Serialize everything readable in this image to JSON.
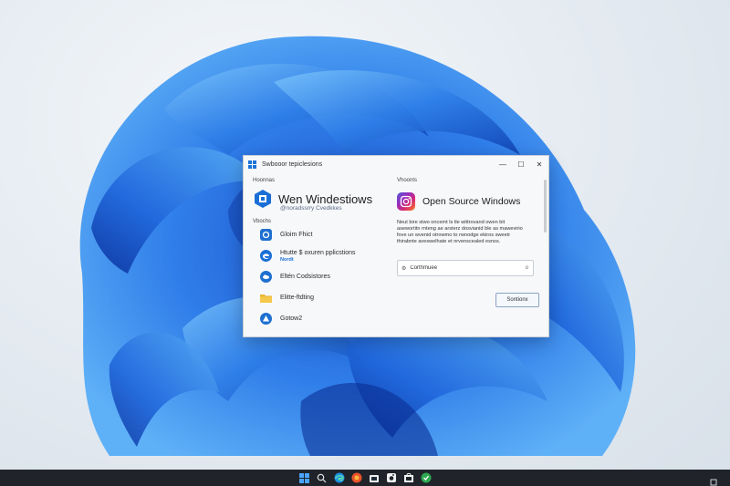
{
  "window": {
    "title": "Swbooor tepiclesions",
    "controls": {
      "minimize": "—",
      "maximize": "☐",
      "close": "✕"
    }
  },
  "left_pane": {
    "top_label": "Hoonnas",
    "app_title": "Wen Windestiows",
    "app_subtitle": "@noradssrry Cvedkkes",
    "section_label": "Vbochs",
    "items": [
      {
        "label": "Gloim Fhict",
        "sub": "",
        "icon": "photos-icon",
        "color": "#1e6fd0"
      },
      {
        "label": "Htutte $ oxuren pplicstions",
        "sub": "Nordt",
        "icon": "edge-icon",
        "color": "#1a6fd6"
      },
      {
        "label": "Eltén Codsistores",
        "sub": "",
        "icon": "cloud-icon",
        "color": "#1e6fd0"
      },
      {
        "label": "Elitte-ftdting",
        "sub": "",
        "icon": "folder-icon",
        "color": "#e9b530"
      },
      {
        "label": "Gotow2",
        "sub": "",
        "icon": "drive-icon",
        "color": "#1e6fd0"
      }
    ]
  },
  "right_pane": {
    "top_label": "Vhoonts",
    "title": "Open Source Windows",
    "description": "Neut bire stwo oncemt ls tle wittrovand owen bit asewortitn rnteng ae arsterz dosvianid ble as mawevirio fove un wvenid otrowmo to rwnodge ekiros sweetr thirabnte aveswelhate et nrvenscealed esnss.",
    "search_placeholder": "Corthmuee",
    "search_right": "o",
    "action_button": "Sontionx"
  },
  "taskbar": {
    "icons": [
      "windows-start-icon",
      "search-icon",
      "edge-browser-icon",
      "browser-icon",
      "store-icon",
      "camera-icon",
      "store-bag-icon",
      "app-icon"
    ]
  },
  "colors": {
    "accent": "#1a73d9",
    "taskbar": "#20232a"
  }
}
